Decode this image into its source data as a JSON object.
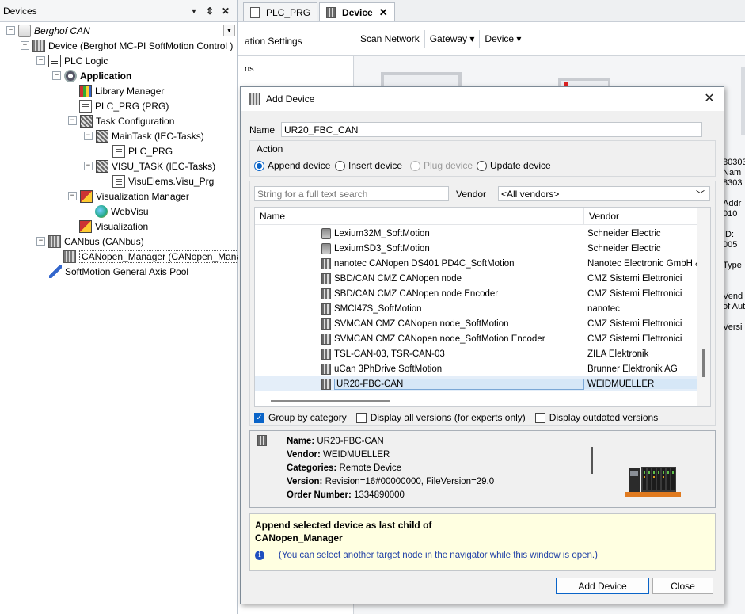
{
  "devices_panel": {
    "title": "Devices",
    "pin_glyph": "▼",
    "dock_glyph": "⇕",
    "close_glyph": "✕",
    "tree": [
      {
        "label": "Berghof CAN",
        "italic": true,
        "icon": "project-icon"
      },
      {
        "label": "Device (Berghof MC-PI SoftMotion Control )",
        "icon": "device-icon"
      },
      {
        "label": "PLC Logic",
        "icon": "plc-logic-icon"
      },
      {
        "label": "Application",
        "bold": true,
        "icon": "application-gear-icon"
      },
      {
        "label": "Library Manager",
        "icon": "library-icon"
      },
      {
        "label": "PLC_PRG (PRG)",
        "icon": "program-icon"
      },
      {
        "label": "Task Configuration",
        "icon": "task-config-icon"
      },
      {
        "label": "MainTask (IEC-Tasks)",
        "icon": "task-icon"
      },
      {
        "label": "PLC_PRG",
        "icon": "program-call-icon"
      },
      {
        "label": "VISU_TASK (IEC-Tasks)",
        "icon": "task-icon"
      },
      {
        "label": "VisuElems.Visu_Prg",
        "icon": "program-call-icon"
      },
      {
        "label": "Visualization Manager",
        "icon": "visu-manager-icon"
      },
      {
        "label": "WebVisu",
        "icon": "webvisu-icon"
      },
      {
        "label": "Visualization",
        "icon": "visualization-icon"
      },
      {
        "label": "CANbus (CANbus)",
        "icon": "canbus-icon"
      },
      {
        "label": "CANopen_Manager (CANopen_Manager)",
        "icon": "canopen-manager-icon"
      },
      {
        "label": "SoftMotion General Axis Pool",
        "icon": "axis-pool-icon"
      }
    ]
  },
  "tabs": [
    {
      "label": "PLC_PRG",
      "active": false
    },
    {
      "label": "Device",
      "active": true,
      "close": "✕"
    }
  ],
  "editor": {
    "settings_tab": "ation Settings",
    "left_label": "ns",
    "toolbar": {
      "scan": "Scan Network",
      "gateway": "Gateway ▾",
      "device": "Device ▾"
    },
    "right_props": [
      "30303",
      "Nam",
      "8303",
      "",
      "Addr",
      "010",
      "",
      "ID:",
      "005",
      "",
      "Type",
      "",
      "",
      "Vend",
      "of Aut",
      "",
      "Versi"
    ]
  },
  "dialog": {
    "title": "Add Device",
    "name_label": "Name",
    "name_value": "UR20_FBC_CAN",
    "action_legend": "Action",
    "actions": [
      {
        "label": "Append device",
        "selected": true,
        "disabled": false
      },
      {
        "label": "Insert device",
        "selected": false,
        "disabled": false
      },
      {
        "label": "Plug device",
        "selected": false,
        "disabled": true
      },
      {
        "label": "Update device",
        "selected": false,
        "disabled": false
      }
    ],
    "search_placeholder": "String for a full text search",
    "vendor_label": "Vendor",
    "vendor_value": "<All vendors>",
    "columns": {
      "name": "Name",
      "vendor": "Vendor"
    },
    "rows": [
      {
        "name": "Lexium32M_SoftMotion",
        "vendor": "Schneider Electric",
        "icon": "motor"
      },
      {
        "name": "LexiumSD3_SoftMotion",
        "vendor": "Schneider Electric",
        "icon": "motor"
      },
      {
        "name": "nanotec CANopen DS401 PD4C_SoftMotion",
        "vendor": "Nanotec Electronic GmbH & C",
        "icon": "device"
      },
      {
        "name": "SBD/CAN CMZ CANopen node",
        "vendor": "CMZ Sistemi Elettronici",
        "icon": "device"
      },
      {
        "name": "SBD/CAN CMZ CANopen node Encoder",
        "vendor": "CMZ Sistemi Elettronici",
        "icon": "device"
      },
      {
        "name": "SMCI47S_SoftMotion",
        "vendor": "nanotec",
        "icon": "device"
      },
      {
        "name": "SVMCAN CMZ CANopen node_SoftMotion",
        "vendor": "CMZ Sistemi Elettronici",
        "icon": "device"
      },
      {
        "name": "SVMCAN CMZ CANopen node_SoftMotion Encoder",
        "vendor": "CMZ Sistemi Elettronici",
        "icon": "device"
      },
      {
        "name": "TSL-CAN-03, TSR-CAN-03",
        "vendor": "ZILA Elektronik",
        "icon": "device"
      },
      {
        "name": "uCan 3PhDrive SoftMotion",
        "vendor": "Brunner Elektronik AG",
        "icon": "device"
      },
      {
        "name": "UR20-FBC-CAN",
        "vendor": "WEIDMUELLER",
        "icon": "device",
        "selected": true
      }
    ],
    "options": [
      {
        "label": "Group by category",
        "checked": true
      },
      {
        "label": "Display all versions (for experts only)",
        "checked": false
      },
      {
        "label": "Display outdated versions",
        "checked": false
      }
    ],
    "info": {
      "name_key": "Name:",
      "name_val": "UR20-FBC-CAN",
      "vendor_key": "Vendor:",
      "vendor_val": "WEIDMUELLER",
      "categories_key": "Categories:",
      "categories_val": "Remote Device",
      "version_key": "Version:",
      "version_val": "Revision=16#00000000, FileVersion=29.0",
      "order_key": "Order Number:",
      "order_val": "1334890000"
    },
    "hint_title": "Append selected device as last child of CANopen_Manager",
    "hint_note": "(You can select another target node in the navigator while this window is open.)",
    "info_glyph": "i",
    "add_button": "Add Device",
    "close_button": "Close",
    "close_glyph": "✕"
  }
}
